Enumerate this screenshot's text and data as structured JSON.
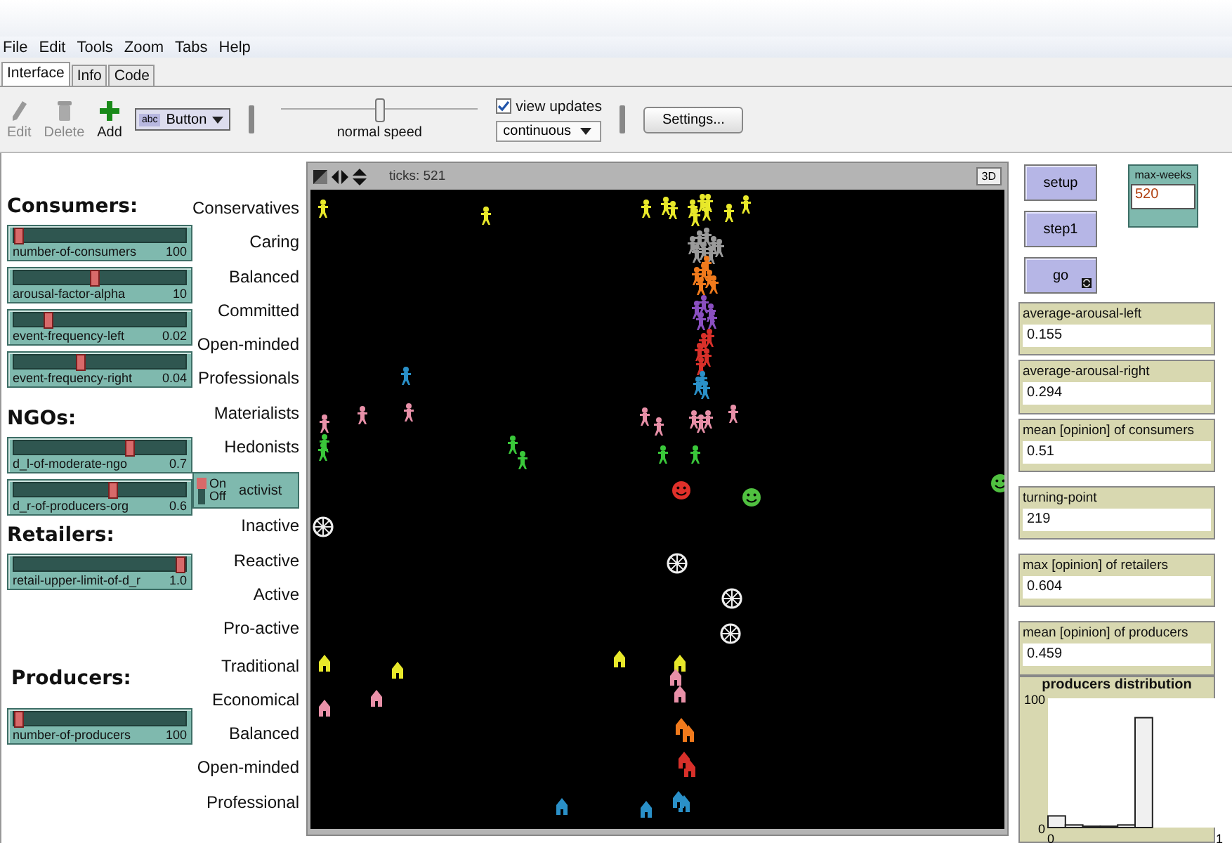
{
  "menu": [
    "File",
    "Edit",
    "Tools",
    "Zoom",
    "Tabs",
    "Help"
  ],
  "tabs": [
    {
      "label": "Interface",
      "selected": true
    },
    {
      "label": "Info",
      "selected": false
    },
    {
      "label": "Code",
      "selected": false
    }
  ],
  "toolbar": {
    "tools": [
      {
        "label": "Edit",
        "kind": "edit",
        "disabled": true
      },
      {
        "label": "Delete",
        "kind": "delete",
        "disabled": true
      },
      {
        "label": "Add",
        "kind": "add",
        "disabled": false
      }
    ],
    "widget_picker": {
      "icon_text": "abc",
      "value": "Button"
    },
    "speed": {
      "label": "normal speed",
      "level": 0.5
    },
    "view_updates": {
      "label": "view updates",
      "checked": true
    },
    "update_mode": "continuous",
    "settings_button": "Settings..."
  },
  "sections": [
    {
      "title": "Consumers:",
      "sliders": [
        {
          "name": "number-of-consumers",
          "value": "100",
          "level": 0
        },
        {
          "name": "arousal-factor-alpha",
          "value": "10",
          "level": 0.47
        },
        {
          "name": "event-frequency-left",
          "value": "0.02",
          "level": 0.18
        },
        {
          "name": "event-frequency-right",
          "value": "0.04",
          "level": 0.38
        }
      ]
    },
    {
      "title": "NGOs:",
      "sliders": [
        {
          "name": "d_l-of-moderate-ngo",
          "value": "0.7",
          "level": 0.69
        },
        {
          "name": "d_r-of-producers-org",
          "value": "0.6",
          "level": 0.58
        }
      ]
    },
    {
      "title": "Retailers:",
      "sliders": [
        {
          "name": "retail-upper-limit-of-d_r",
          "value": "1.0",
          "level": 1
        }
      ]
    },
    {
      "title": "Producers:",
      "sliders": [
        {
          "name": "number-of-producers",
          "value": "100",
          "level": 0
        }
      ]
    }
  ],
  "label_groups": [
    [
      "Conservatives",
      "Caring",
      "Balanced",
      "Committed",
      "Open-minded",
      "Professionals",
      "Materialists",
      "Hedonists"
    ],
    [
      "Inactive",
      "Reactive",
      "Active",
      "Pro-active"
    ],
    [
      "Traditional",
      "Economical",
      "Balanced",
      "Open-minded",
      "Professional"
    ]
  ],
  "switch": {
    "on_label": "On",
    "off_label": "Off",
    "name": "activist",
    "on": true
  },
  "view": {
    "ticks": "ticks: 521",
    "button_3d": "3D"
  },
  "buttons": [
    {
      "label": "setup",
      "forever": false
    },
    {
      "label": "step1",
      "forever": false
    },
    {
      "label": "go",
      "forever": true
    }
  ],
  "input": {
    "label": "max-weeks",
    "value": "520"
  },
  "monitors": [
    {
      "label": "average-arousal-left",
      "value": "0.155"
    },
    {
      "label": "average-arousal-right",
      "value": "0.294"
    },
    {
      "label": "mean [opinion] of consumers",
      "value": "0.51"
    },
    {
      "label": "turning-point",
      "value": "219"
    },
    {
      "label": "max [opinion] of retailers",
      "value": "0.604"
    },
    {
      "label": "mean [opinion] of producers",
      "value": "0.459"
    }
  ],
  "plot": {
    "chart_data": {
      "type": "bar",
      "title": "producers distribution",
      "x": [
        0.05,
        0.15,
        0.25,
        0.35,
        0.45,
        0.55
      ],
      "values": [
        9,
        2,
        1,
        1,
        2,
        85
      ],
      "xlim": [
        0,
        1
      ],
      "ylim": [
        0,
        100
      ],
      "xticks": [
        0,
        1
      ],
      "yticks": [
        0,
        100
      ]
    }
  }
}
